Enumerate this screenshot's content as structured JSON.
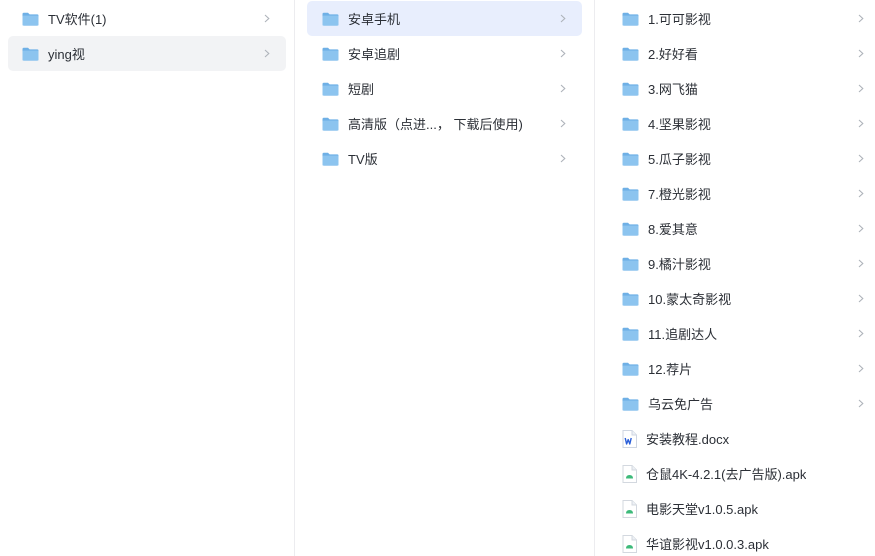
{
  "columns": [
    {
      "items": [
        {
          "label": "TV软件(1)",
          "type": "folder",
          "selected": false
        },
        {
          "label": "ying视",
          "type": "folder",
          "selected": true
        }
      ]
    },
    {
      "items": [
        {
          "label": "安卓手机",
          "type": "folder",
          "selected": true
        },
        {
          "label": "安卓追剧",
          "type": "folder",
          "selected": false
        },
        {
          "label": "短剧",
          "type": "folder",
          "selected": false
        },
        {
          "label": "高清版（点进...， 下载后使用)",
          "type": "folder",
          "selected": false
        },
        {
          "label": "TV版",
          "type": "folder",
          "selected": false
        }
      ]
    },
    {
      "items": [
        {
          "label": "1.可可影视",
          "type": "folder"
        },
        {
          "label": "2.好好看",
          "type": "folder"
        },
        {
          "label": "3.网飞猫",
          "type": "folder"
        },
        {
          "label": "4.坚果影视",
          "type": "folder"
        },
        {
          "label": "5.瓜子影视",
          "type": "folder"
        },
        {
          "label": "7.橙光影视",
          "type": "folder"
        },
        {
          "label": "8.爱其意",
          "type": "folder"
        },
        {
          "label": "9.橘汁影视",
          "type": "folder"
        },
        {
          "label": "10.蒙太奇影视",
          "type": "folder"
        },
        {
          "label": "11.追剧达人",
          "type": "folder"
        },
        {
          "label": "12.荐片",
          "type": "folder"
        },
        {
          "label": "乌云免广告",
          "type": "folder"
        },
        {
          "label": "安装教程.docx",
          "type": "docx"
        },
        {
          "label": "仓鼠4K-4.2.1(去广告版).apk",
          "type": "apk"
        },
        {
          "label": "电影天堂v1.0.5.apk",
          "type": "apk"
        },
        {
          "label": "华谊影视v1.0.0.3.apk",
          "type": "apk"
        }
      ]
    }
  ],
  "icons": {
    "folder": "folder-icon",
    "docx": "word-document-icon",
    "apk": "apk-file-icon",
    "chevron": "chevron-right-icon"
  },
  "colors": {
    "folder_body": "#8cc4ef",
    "folder_tab": "#6fb0e6",
    "selected_active": "#e8eefd",
    "selected_inactive": "#f2f3f5",
    "word_blue": "#2b5fd9",
    "apk_green": "#3dba7a"
  }
}
